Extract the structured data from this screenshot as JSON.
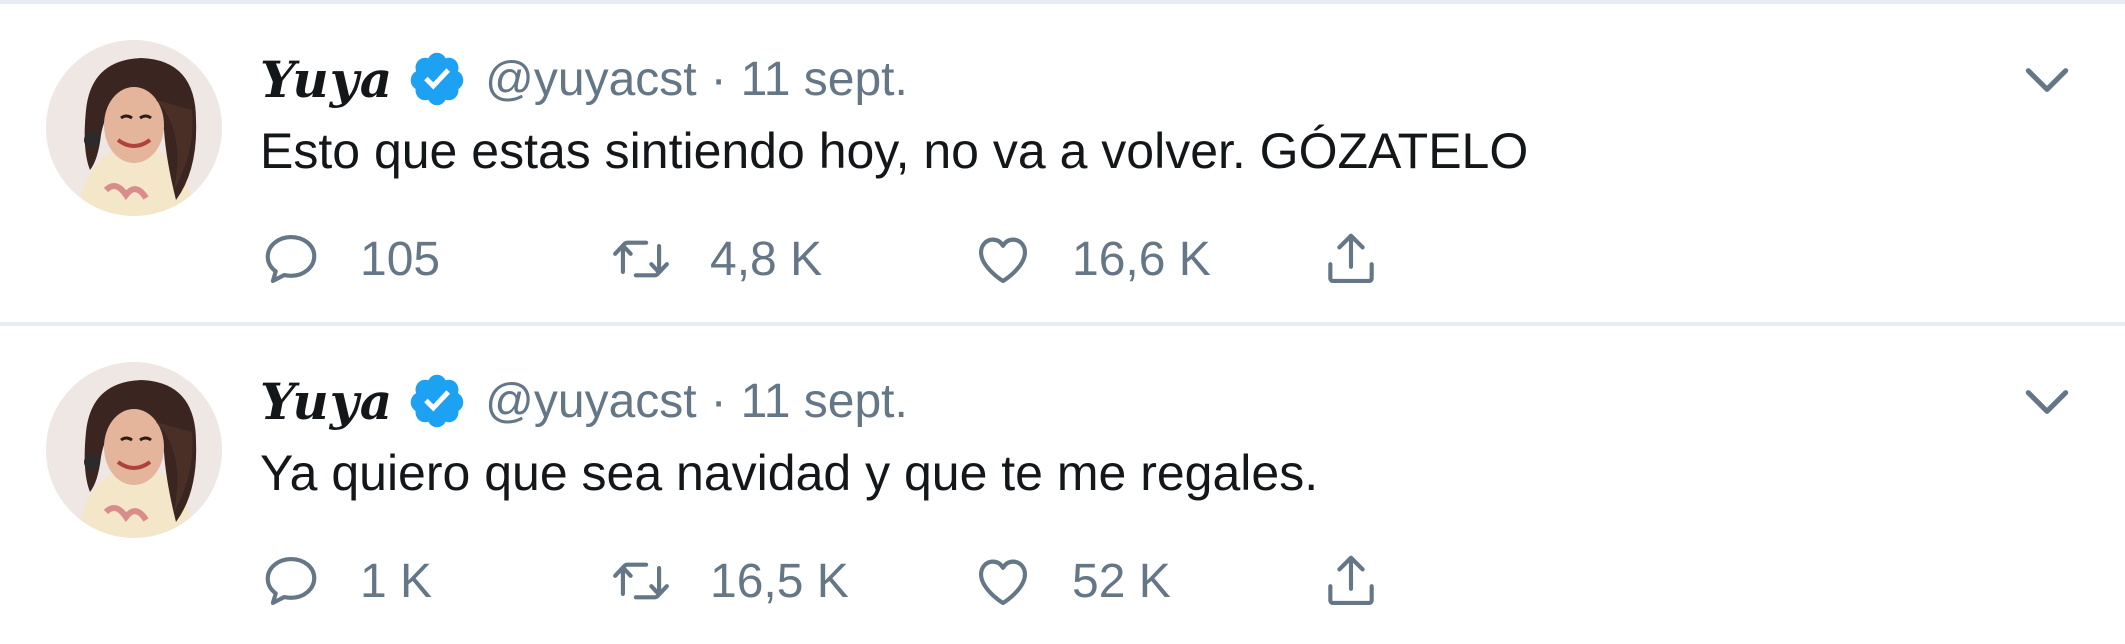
{
  "tweets": [
    {
      "display_name": "Yuya",
      "handle": "@yuyacst",
      "separator": "·",
      "date": "11 sept.",
      "text": "Esto que estas sintiendo hoy, no va a volver. GÓZATELO",
      "reply_count": "105",
      "retweet_count": "4,8 K",
      "like_count": "16,6 K"
    },
    {
      "display_name": "Yuya",
      "handle": "@yuyacst",
      "separator": "·",
      "date": "11 sept.",
      "text": "Ya quiero que sea navidad y que te me regales.",
      "reply_count": "1 K",
      "retweet_count": "16,5 K",
      "like_count": "52 K"
    }
  ],
  "icons": {
    "verified": "verified-badge-icon",
    "menu": "chevron-down-icon",
    "reply": "reply-icon",
    "retweet": "retweet-icon",
    "like": "heart-icon",
    "share": "share-icon"
  },
  "colors": {
    "verified_blue": "#1da1f2",
    "secondary_text": "#657786",
    "primary_text": "#14171a",
    "divider": "#e6ecf0"
  }
}
